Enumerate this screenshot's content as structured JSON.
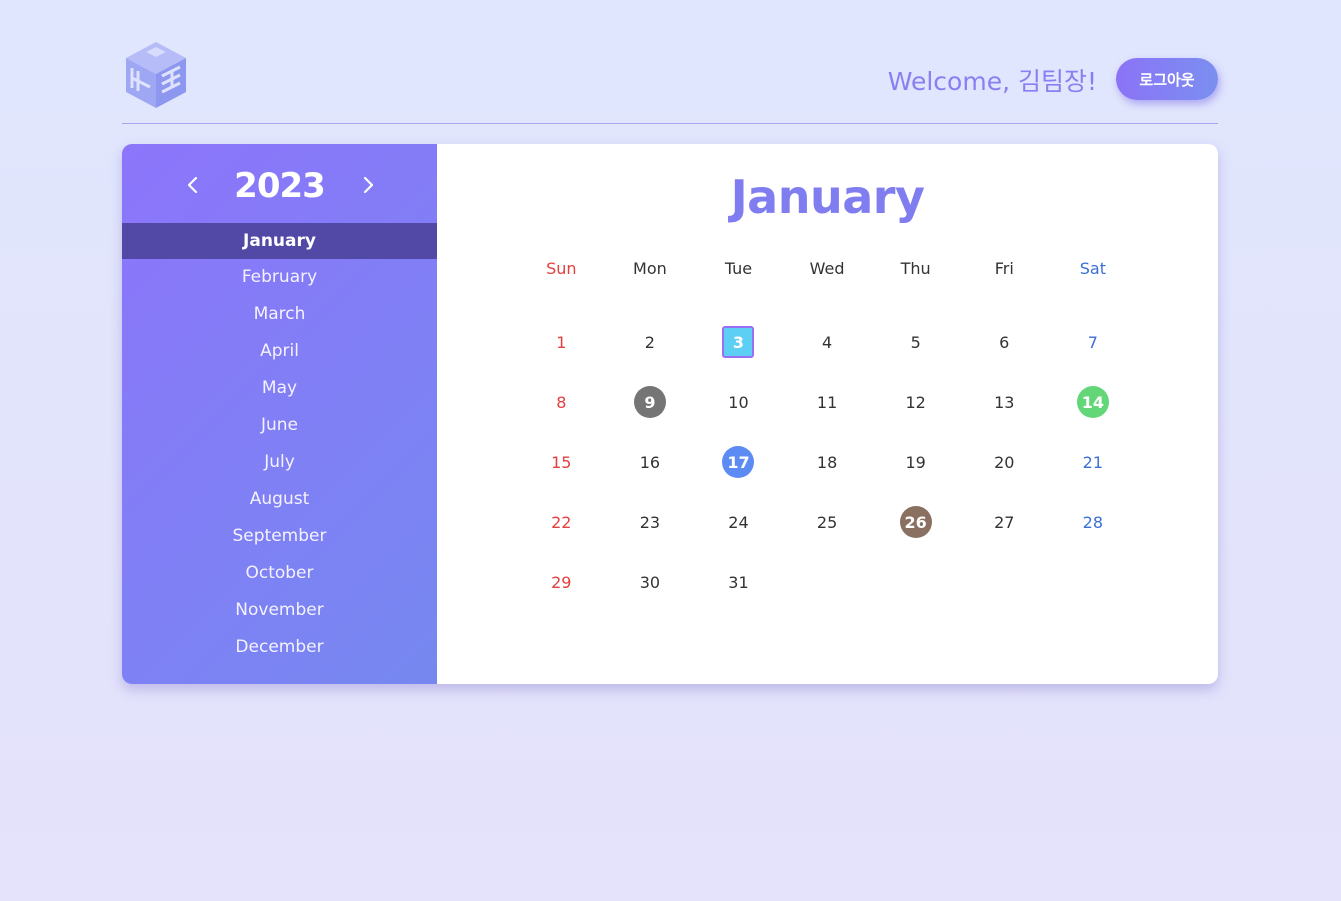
{
  "header": {
    "welcome_text": "Welcome, 김팀장!",
    "logout_label": "로그아웃"
  },
  "sidebar": {
    "year": "2023",
    "months": [
      "January",
      "February",
      "March",
      "April",
      "May",
      "June",
      "July",
      "August",
      "September",
      "October",
      "November",
      "December"
    ],
    "active_month_index": 0
  },
  "calendar": {
    "title": "January",
    "weekdays": [
      "Sun",
      "Mon",
      "Tue",
      "Wed",
      "Thu",
      "Fri",
      "Sat"
    ],
    "first_weekday_index": 0,
    "days_in_month": 31,
    "today": 3,
    "marked_days": [
      {
        "day": 9,
        "style": "mark-gray",
        "color": "#757575"
      },
      {
        "day": 14,
        "style": "mark-green",
        "color": "#63d777"
      },
      {
        "day": 17,
        "style": "mark-blue",
        "color": "#5c8cf3"
      },
      {
        "day": 26,
        "style": "mark-brown",
        "color": "#8a7060"
      }
    ]
  },
  "colors": {
    "accent": "#8b7ef2",
    "sunday": "#e53e3e",
    "saturday": "#3b6fd6",
    "active_month_bg": "#5248a6",
    "today_bg": "#5dcff4"
  },
  "icons": {
    "logo": "cube-logo-icon",
    "prev": "chevron-left-icon",
    "next": "chevron-right-icon"
  }
}
